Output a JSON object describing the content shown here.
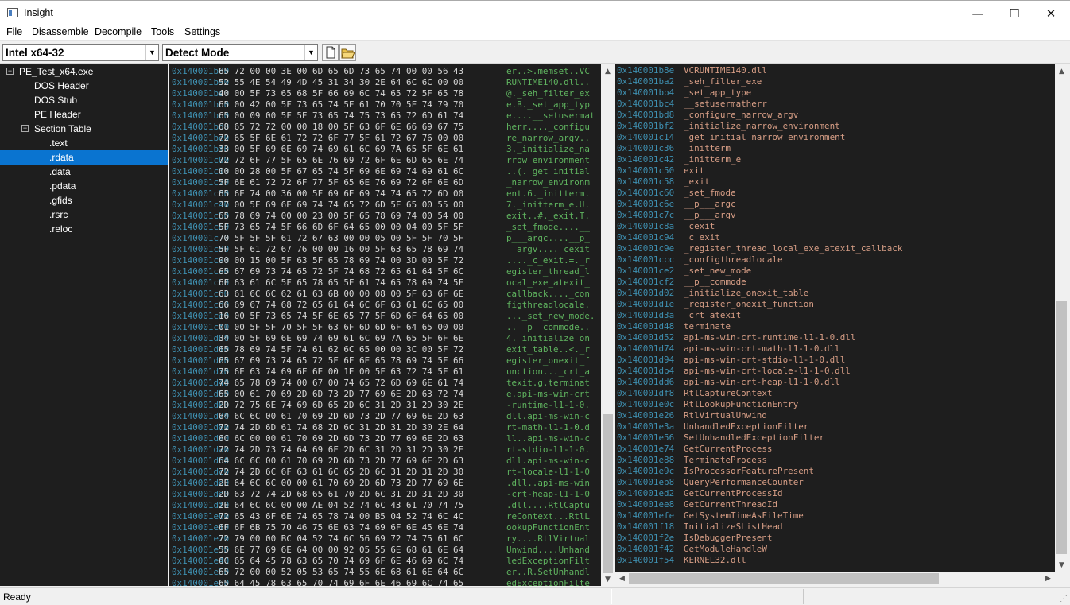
{
  "window": {
    "title": "Insight",
    "minimize": "—",
    "maximize": "☐",
    "close": "✕"
  },
  "menu": [
    "File",
    "Disassemble",
    "Decompile",
    "Tools",
    "Settings"
  ],
  "toolbar": {
    "arch": "Intel x64-32",
    "mode": "Detect Mode"
  },
  "tree": {
    "root": "PE_Test_x64.exe",
    "items": [
      "DOS Header",
      "DOS Stub",
      "PE Header"
    ],
    "section_table": "Section Table",
    "sections": [
      ".text",
      ".rdata",
      ".data",
      ".pdata",
      ".gfids",
      ".rsrc",
      ".reloc"
    ],
    "selected": ".rdata"
  },
  "hex_rows": [
    [
      "0x140001b80",
      "65 72 00 00 3E 00 6D 65 6D 73 65 74 00 00 56 43",
      "er..>.memset..VC"
    ],
    [
      "0x140001b90",
      "52 55 4E 54 49 4D 45 31 34 30 2E 64 6C 6C 00 00",
      "RUNTIME140.dll.."
    ],
    [
      "0x140001ba0",
      "40 00 5F 73 65 68 5F 66 69 6C 74 65 72 5F 65 78",
      "@._seh_filter_ex"
    ],
    [
      "0x140001bb0",
      "65 00 42 00 5F 73 65 74 5F 61 70 70 5F 74 79 70",
      "e.B._set_app_typ"
    ],
    [
      "0x140001bc0",
      "65 00 09 00 5F 5F 73 65 74 75 73 65 72 6D 61 74",
      "e....__setusermat"
    ],
    [
      "0x140001bd0",
      "68 65 72 72 00 00 18 00 5F 63 6F 6E 66 69 67 75",
      "herr...._configu"
    ],
    [
      "0x140001be0",
      "72 65 5F 6E 61 72 72 6F 77 5F 61 72 67 76 00 00",
      "re_narrow_argv.."
    ],
    [
      "0x140001bf0",
      "33 00 5F 69 6E 69 74 69 61 6C 69 7A 65 5F 6E 61",
      "3._initialize_na"
    ],
    [
      "0x140001c00",
      "72 72 6F 77 5F 65 6E 76 69 72 6F 6E 6D 65 6E 74",
      "rrow_environment"
    ],
    [
      "0x140001c10",
      "00 00 28 00 5F 67 65 74 5F 69 6E 69 74 69 61 6C",
      "..(._get_initial"
    ],
    [
      "0x140001c20",
      "5F 6E 61 72 72 6F 77 5F 65 6E 76 69 72 6F 6E 6D",
      "_narrow_environm"
    ],
    [
      "0x140001c30",
      "65 6E 74 00 36 00 5F 69 6E 69 74 74 65 72 6D 00",
      "ent.6._initterm."
    ],
    [
      "0x140001c40",
      "37 00 5F 69 6E 69 74 74 65 72 6D 5F 65 00 55 00",
      "7._initterm_e.U."
    ],
    [
      "0x140001c50",
      "65 78 69 74 00 00 23 00 5F 65 78 69 74 00 54 00",
      "exit..#._exit.T."
    ],
    [
      "0x140001c60",
      "5F 73 65 74 5F 66 6D 6F 64 65 00 00 04 00 5F 5F",
      "_set_fmode....__"
    ],
    [
      "0x140001c70",
      "70 5F 5F 5F 61 72 67 63 00 00 05 00 5F 5F 70 5F",
      "p___argc....__p_"
    ],
    [
      "0x140001c80",
      "5F 5F 61 72 67 76 00 00 16 00 5F 63 65 78 69 74",
      "__argv...._cexit"
    ],
    [
      "0x140001c90",
      "00 00 15 00 5F 63 5F 65 78 69 74 00 3D 00 5F 72",
      "...._c_exit.=._r"
    ],
    [
      "0x140001ca0",
      "65 67 69 73 74 65 72 5F 74 68 72 65 61 64 5F 6C",
      "egister_thread_l"
    ],
    [
      "0x140001cb0",
      "6F 63 61 6C 5F 65 78 65 5F 61 74 65 78 69 74 5F",
      "ocal_exe_atexit_"
    ],
    [
      "0x140001cc0",
      "63 61 6C 6C 62 61 63 6B 00 00 08 00 5F 63 6F 6E",
      "callback...._con"
    ],
    [
      "0x140001cd0",
      "66 69 67 74 68 72 65 61 64 6C 6F 63 61 6C 65 00",
      "figthreadlocale."
    ],
    [
      "0x140001ce0",
      "16 00 5F 73 65 74 5F 6E 65 77 5F 6D 6F 64 65 00",
      "..._set_new_mode."
    ],
    [
      "0x140001cf0",
      "01 00 5F 5F 70 5F 5F 63 6F 6D 6D 6F 64 65 00 00",
      "..__p__commode.."
    ],
    [
      "0x140001d00",
      "34 00 5F 69 6E 69 74 69 61 6C 69 7A 65 5F 6F 6E",
      "4._initialize_on"
    ],
    [
      "0x140001d10",
      "65 78 69 74 5F 74 61 62 6C 65 00 00 3C 00 5F 72",
      "exit_table..<._r"
    ],
    [
      "0x140001d20",
      "65 67 69 73 74 65 72 5F 6F 6E 65 78 69 74 5F 66",
      "egister_onexit_f"
    ],
    [
      "0x140001d30",
      "75 6E 63 74 69 6F 6E 00 1E 00 5F 63 72 74 5F 61",
      "unction..._crt_a"
    ],
    [
      "0x140001d40",
      "74 65 78 69 74 00 67 00 74 65 72 6D 69 6E 61 74",
      "texit.g.terminat"
    ],
    [
      "0x140001d50",
      "65 00 61 70 69 2D 6D 73 2D 77 69 6E 2D 63 72 74",
      "e.api-ms-win-crt"
    ],
    [
      "0x140001d60",
      "2D 72 75 6E 74 69 6D 65 2D 6C 31 2D 31 2D 30 2E",
      "-runtime-l1-1-0."
    ],
    [
      "0x140001d70",
      "64 6C 6C 00 61 70 69 2D 6D 73 2D 77 69 6E 2D 63",
      "dll.api-ms-win-c"
    ],
    [
      "0x140001d80",
      "72 74 2D 6D 61 74 68 2D 6C 31 2D 31 2D 30 2E 64",
      "rt-math-l1-1-0.d"
    ],
    [
      "0x140001d90",
      "6C 6C 00 00 61 70 69 2D 6D 73 2D 77 69 6E 2D 63",
      "ll..api-ms-win-c"
    ],
    [
      "0x140001da0",
      "72 74 2D 73 74 64 69 6F 2D 6C 31 2D 31 2D 30 2E",
      "rt-stdio-l1-1-0."
    ],
    [
      "0x140001db0",
      "64 6C 6C 00 61 70 69 2D 6D 73 2D 77 69 6E 2D 63",
      "dll.api-ms-win-c"
    ],
    [
      "0x140001dc0",
      "72 74 2D 6C 6F 63 61 6C 65 2D 6C 31 2D 31 2D 30",
      "rt-locale-l1-1-0"
    ],
    [
      "0x140001dd0",
      "2E 64 6C 6C 00 00 61 70 69 2D 6D 73 2D 77 69 6E",
      ".dll..api-ms-win"
    ],
    [
      "0x140001de0",
      "2D 63 72 74 2D 68 65 61 70 2D 6C 31 2D 31 2D 30",
      "-crt-heap-l1-1-0"
    ],
    [
      "0x140001df0",
      "2E 64 6C 6C 00 00 AE 04 52 74 6C 43 61 70 74 75",
      ".dll....RtlCaptu"
    ],
    [
      "0x140001e00",
      "72 65 43 6F 6E 74 65 78 74 00 B5 04 52 74 6C 4C",
      "reContext...RtlL"
    ],
    [
      "0x140001e10",
      "6F 6F 6B 75 70 46 75 6E 63 74 69 6F 6E 45 6E 74",
      "ookupFunctionEnt"
    ],
    [
      "0x140001e20",
      "72 79 00 00 BC 04 52 74 6C 56 69 72 74 75 61 6C",
      "ry....RtlVirtual"
    ],
    [
      "0x140001e30",
      "55 6E 77 69 6E 64 00 00 92 05 55 6E 68 61 6E 64",
      "Unwind....Unhand"
    ],
    [
      "0x140001e40",
      "6C 65 64 45 78 63 65 70 74 69 6F 6E 46 69 6C 74",
      "ledExceptionFilt"
    ],
    [
      "0x140001e50",
      "65 72 00 00 52 05 53 65 74 55 6E 68 61 6E 64 6C",
      "er..R.SetUnhandl"
    ],
    [
      "0x140001e60",
      "65 64 45 78 63 65 70 74 69 6F 6E 46 69 6C 74 65",
      "edExceptionFilte"
    ]
  ],
  "strings": [
    [
      "0x140001b8e",
      "VCRUNTIME140.dll"
    ],
    [
      "0x140001ba2",
      "_seh_filter_exe"
    ],
    [
      "0x140001bb4",
      "_set_app_type"
    ],
    [
      "0x140001bc4",
      "__setusermatherr"
    ],
    [
      "0x140001bd8",
      "_configure_narrow_argv"
    ],
    [
      "0x140001bf2",
      "_initialize_narrow_environment"
    ],
    [
      "0x140001c14",
      "_get_initial_narrow_environment"
    ],
    [
      "0x140001c36",
      "_initterm"
    ],
    [
      "0x140001c42",
      "_initterm_e"
    ],
    [
      "0x140001c50",
      "exit"
    ],
    [
      "0x140001c58",
      "_exit"
    ],
    [
      "0x140001c60",
      "_set_fmode"
    ],
    [
      "0x140001c6e",
      "__p___argc"
    ],
    [
      "0x140001c7c",
      "__p___argv"
    ],
    [
      "0x140001c8a",
      "_cexit"
    ],
    [
      "0x140001c94",
      "_c_exit"
    ],
    [
      "0x140001c9e",
      "_register_thread_local_exe_atexit_callback"
    ],
    [
      "0x140001ccc",
      "_configthreadlocale"
    ],
    [
      "0x140001ce2",
      "_set_new_mode"
    ],
    [
      "0x140001cf2",
      "__p__commode"
    ],
    [
      "0x140001d02",
      "_initialize_onexit_table"
    ],
    [
      "0x140001d1e",
      "_register_onexit_function"
    ],
    [
      "0x140001d3a",
      "_crt_atexit"
    ],
    [
      "0x140001d48",
      "terminate"
    ],
    [
      "0x140001d52",
      "api-ms-win-crt-runtime-l1-1-0.dll"
    ],
    [
      "0x140001d74",
      "api-ms-win-crt-math-l1-1-0.dll"
    ],
    [
      "0x140001d94",
      "api-ms-win-crt-stdio-l1-1-0.dll"
    ],
    [
      "0x140001db4",
      "api-ms-win-crt-locale-l1-1-0.dll"
    ],
    [
      "0x140001dd6",
      "api-ms-win-crt-heap-l1-1-0.dll"
    ],
    [
      "0x140001df8",
      "RtlCaptureContext"
    ],
    [
      "0x140001e0c",
      "RtlLookupFunctionEntry"
    ],
    [
      "0x140001e26",
      "RtlVirtualUnwind"
    ],
    [
      "0x140001e3a",
      "UnhandledExceptionFilter"
    ],
    [
      "0x140001e56",
      "SetUnhandledExceptionFilter"
    ],
    [
      "0x140001e74",
      "GetCurrentProcess"
    ],
    [
      "0x140001e88",
      "TerminateProcess"
    ],
    [
      "0x140001e9c",
      "IsProcessorFeaturePresent"
    ],
    [
      "0x140001eb8",
      "QueryPerformanceCounter"
    ],
    [
      "0x140001ed2",
      "GetCurrentProcessId"
    ],
    [
      "0x140001ee8",
      "GetCurrentThreadId"
    ],
    [
      "0x140001efe",
      "GetSystemTimeAsFileTime"
    ],
    [
      "0x140001f18",
      "InitializeSListHead"
    ],
    [
      "0x140001f2e",
      "IsDebuggerPresent"
    ],
    [
      "0x140001f42",
      "GetModuleHandleW"
    ],
    [
      "0x140001f54",
      "KERNEL32.dll"
    ]
  ],
  "status": "Ready",
  "colors": {
    "pane_bg": "#1e1e1e",
    "address": "#3e8fb0",
    "ascii": "#5fb35f",
    "string": "#d69d85",
    "selection": "#0a74d0"
  }
}
